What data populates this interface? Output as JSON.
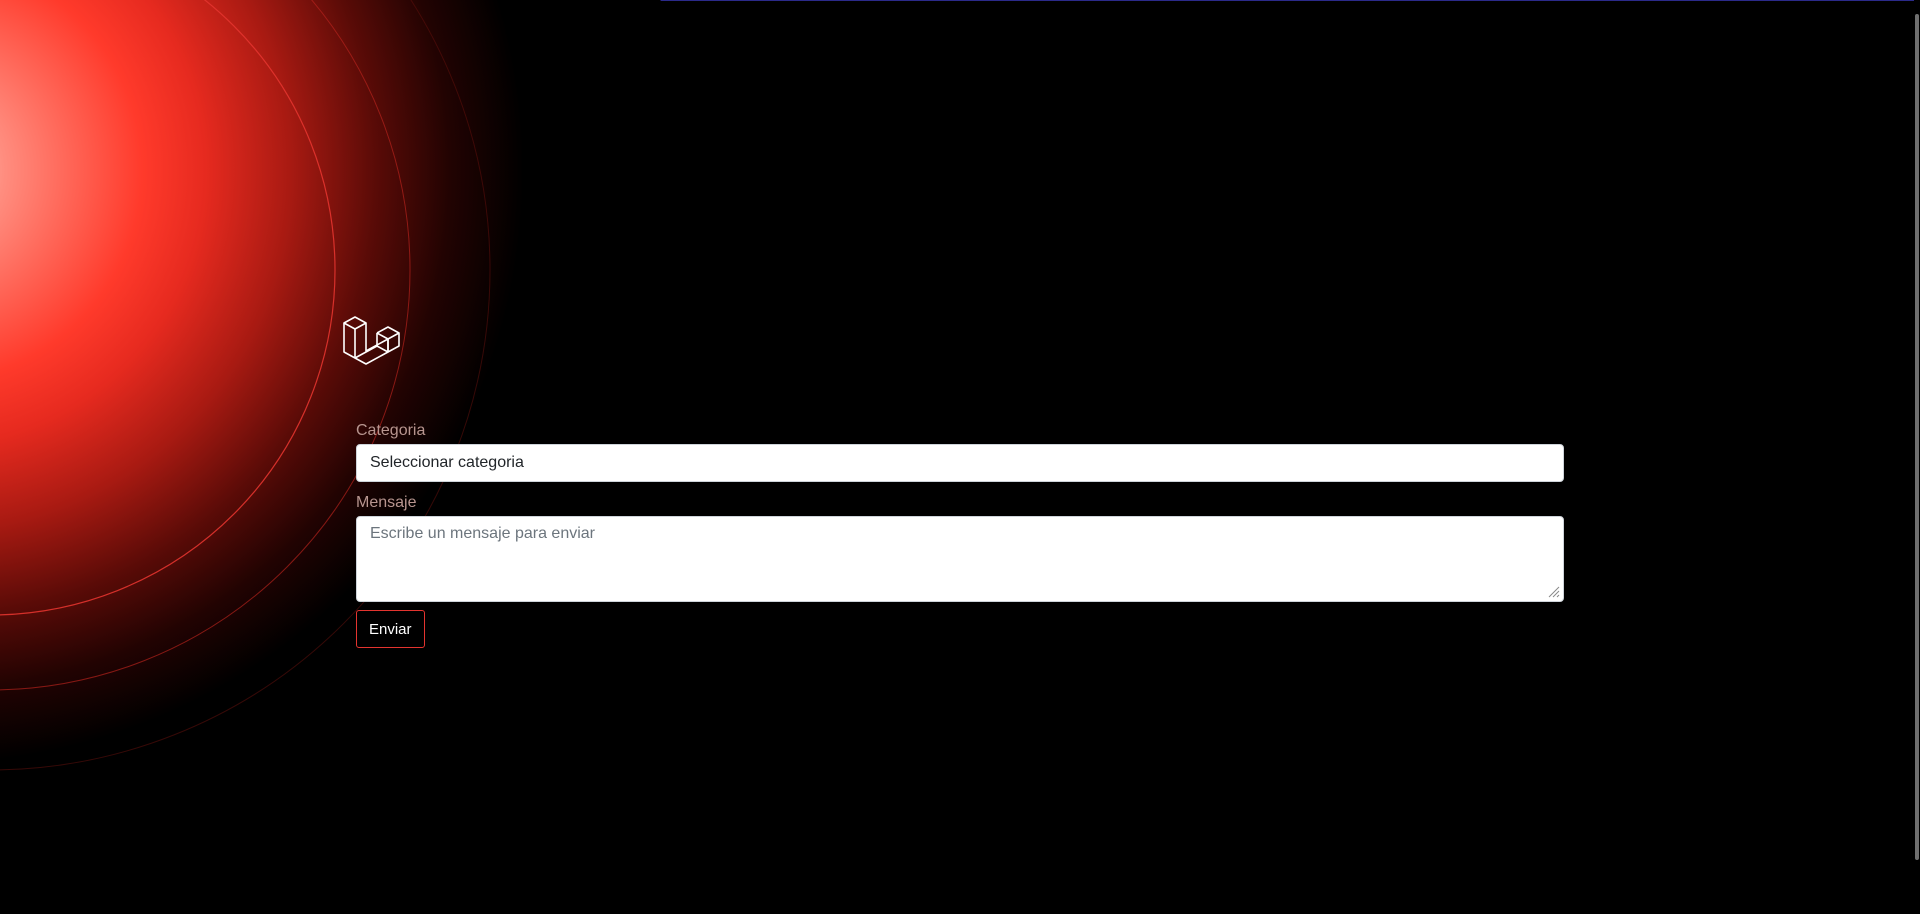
{
  "form": {
    "category": {
      "label": "Categoria",
      "selected": "Seleccionar categoria"
    },
    "message": {
      "label": "Mensaje",
      "placeholder": "Escribe un mensaje para enviar"
    },
    "submit_label": "Enviar"
  },
  "icons": {
    "logo": "laravel-logo-icon",
    "resize": "resize-handle-icon"
  },
  "colors": {
    "background": "#000000",
    "accent": "#e3342f",
    "label": "#b7958f"
  }
}
